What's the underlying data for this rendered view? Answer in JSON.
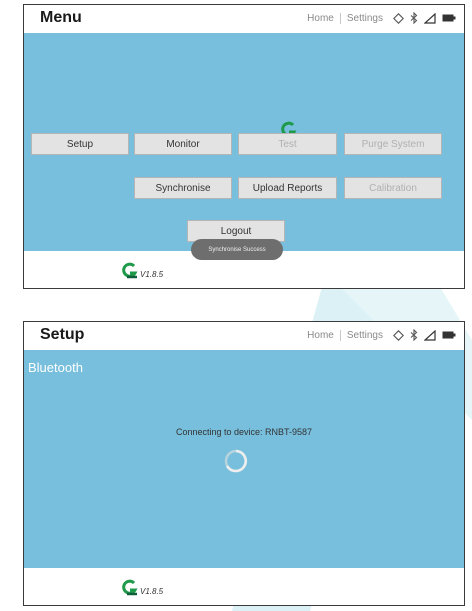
{
  "colors": {
    "panel_bg": "#77bfdd",
    "button_bg": "#e3e3e3",
    "button_text": "#333333",
    "button_disabled_text": "#b0b0b0",
    "toast_bg": "#6e6e6e",
    "logo_green": "#1f9a4a",
    "watermark": "#dcf1f5"
  },
  "icons": [
    "location-icon",
    "bluetooth-icon",
    "signal-icon",
    "battery-icon",
    "app-logo-icon",
    "loading-spinner-icon"
  ],
  "menu_screen": {
    "title": "Menu",
    "nav": {
      "home": "Home",
      "settings": "Settings"
    },
    "buttons": {
      "setup": "Setup",
      "monitor": "Monitor",
      "test": "Test",
      "purge_system": "Purge System",
      "synchronise": "Synchronise",
      "upload_reports": "Upload Reports",
      "calibration": "Calibration",
      "logout": "Logout"
    },
    "toast": "Synchronise Success",
    "version": "V1.8.5"
  },
  "setup_screen": {
    "title": "Setup",
    "nav": {
      "home": "Home",
      "settings": "Settings"
    },
    "section": "Bluetooth",
    "status": "Connecting to device: RNBT-9587",
    "version": "V1.8.5"
  }
}
